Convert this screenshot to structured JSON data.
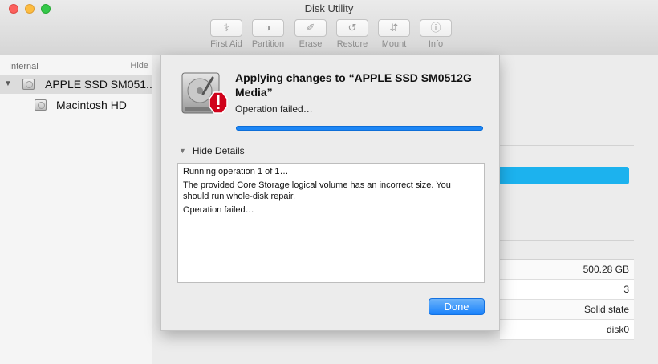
{
  "window": {
    "title": "Disk Utility"
  },
  "toolbar": {
    "items": [
      {
        "label": "First Aid",
        "icon": "stethoscope-icon",
        "glyph": "⚕"
      },
      {
        "label": "Partition",
        "icon": "partition-icon",
        "glyph": "◑"
      },
      {
        "label": "Erase",
        "icon": "erase-icon",
        "glyph": "✐"
      },
      {
        "label": "Restore",
        "icon": "restore-icon",
        "glyph": "↺"
      },
      {
        "label": "Mount",
        "icon": "mount-icon",
        "glyph": "⇵"
      },
      {
        "label": "Info",
        "icon": "info-icon",
        "glyph": "ⓘ"
      }
    ]
  },
  "sidebar": {
    "section_label": "Internal",
    "hide_label": "Hide",
    "disk": {
      "label": "APPLE SSD SM051...",
      "icon": "internal-disk-icon"
    },
    "volume": {
      "label": "Macintosh HD",
      "icon": "volume-disk-icon"
    }
  },
  "info_table": {
    "values": [
      "500.28 GB",
      "3",
      "Solid state",
      "disk0"
    ]
  },
  "sheet": {
    "title": "Applying changes to “APPLE SSD SM0512G Media”",
    "status": "Operation failed…",
    "progress": 1.0,
    "details_toggle": "Hide Details",
    "details_lines": [
      "Running operation 1 of 1…",
      "The provided Core Storage logical volume has an incorrect size. You should run whole-disk repair.",
      "Operation failed…"
    ],
    "done_label": "Done"
  },
  "colors": {
    "accent": "#1d86f5",
    "error_red": "#d0021b",
    "close": "#fc605c",
    "minimize": "#fdbc40",
    "maximize": "#34c84a"
  }
}
